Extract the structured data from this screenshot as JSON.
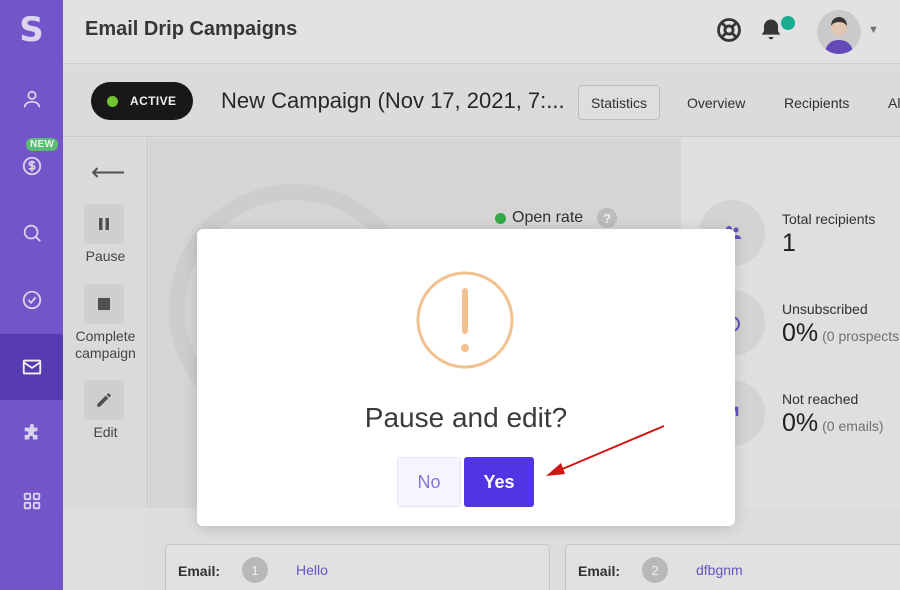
{
  "app": {
    "logo_letter": "S",
    "title": "Email Drip Campaigns",
    "accent_color": "#7b5bd6",
    "sidebar_active_color": "#5c3fbd"
  },
  "sidebar": {
    "new_badge": "NEW",
    "items": [
      {
        "icon": "user-icon"
      },
      {
        "icon": "dollar-icon"
      },
      {
        "icon": "search-icon"
      },
      {
        "icon": "check-circle-icon"
      },
      {
        "icon": "mail-icon",
        "active": true
      },
      {
        "icon": "puzzle-icon"
      },
      {
        "icon": "grid-icon"
      }
    ]
  },
  "campaign": {
    "status": "ACTIVE",
    "status_color": "#7bd03b",
    "name": "New Campaign (Nov 17, 2021, 7:...",
    "tabs": [
      {
        "label": "Statistics",
        "selected": true
      },
      {
        "label": "Overview"
      },
      {
        "label": "Recipients"
      },
      {
        "label": "Al"
      }
    ]
  },
  "actions": {
    "back_arrow": "⟵",
    "pause_label": "Pause",
    "complete_label": "Complete campaign",
    "edit_label": "Edit"
  },
  "main": {
    "open_rate_label": "Open rate",
    "help_glyph": "?"
  },
  "stats": [
    {
      "label": "Total recipients",
      "value": "1",
      "sub": ""
    },
    {
      "label": "Unsubscribed",
      "value": "0%",
      "sub": "(0 prospects"
    },
    {
      "label": "Not reached",
      "value": "0%",
      "sub": "(0 emails)"
    }
  ],
  "emails": [
    {
      "label": "Email:",
      "num": "1",
      "subject": "Hello"
    },
    {
      "label": "Email:",
      "num": "2",
      "subject": "dfbgnm"
    }
  ],
  "modal": {
    "icon": "warning-icon",
    "icon_color": "#f3c08f",
    "title": "Pause and edit?",
    "no_label": "No",
    "yes_label": "Yes",
    "yes_color": "#5334e2"
  },
  "annotation": {
    "arrow_color": "#d01515"
  }
}
